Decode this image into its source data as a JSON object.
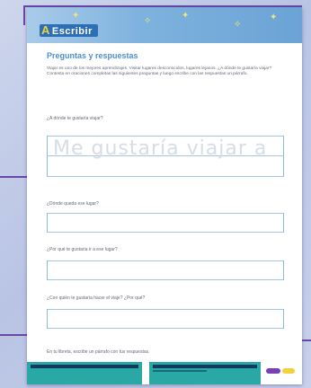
{
  "banner": {
    "label": "Escribir",
    "letter": "A",
    "colors": {
      "band": "#7fb3de",
      "tag": "#2d6fb6",
      "accent": "#f0d23c"
    }
  },
  "title": "Preguntas y respuestas",
  "intro": "Viajar es uno de los mejores aprendizajes. Visitar lugares desconocidos, lugares lejanos. ¿A dónde te gustaría viajar? Contesta en oraciones completas las siguientes preguntas y luego escribe con las respuestas un párrafo.",
  "questions": [
    {
      "label": "¿A dónde te gustaría viajar?",
      "trace": "Me gustaría viajar a"
    },
    {
      "label": "¿Dónde queda ese lugar?"
    },
    {
      "label": "¿Por qué te gustaría ir a ese lugar?"
    },
    {
      "label": "¿Con quién te gustaría hacer el viaje? ¿Por qué?"
    }
  ],
  "final_instruction": "En tu libreta, escribe un párrafo con tus respuestas.",
  "frame_color": "#6b46a6"
}
